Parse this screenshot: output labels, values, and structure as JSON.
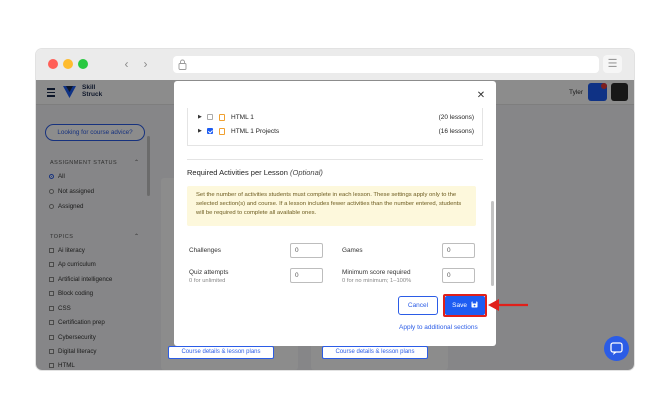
{
  "browser": {
    "dots": [
      "#ff5f57",
      "#febc2e",
      "#28c840"
    ],
    "back_icon": "chevron-left-icon",
    "forward_icon": "chevron-right-icon",
    "menu_icon": "hamburger-icon"
  },
  "app": {
    "logo_line1": "Skill",
    "logo_line2": "Struck",
    "user_name": "Tyler"
  },
  "sidebar": {
    "advice_button": "Looking for course advice?",
    "assignment_status_heading": "ASSIGNMENT STATUS",
    "status_options": [
      "All",
      "Not assigned",
      "Assigned"
    ],
    "selected_status": "All",
    "topics_heading": "TOPICS",
    "topics": [
      "Ai literacy",
      "Ap curriculum",
      "Artificial intelligence",
      "Block coding",
      "CSS",
      "Certification prep",
      "Cybersecurity",
      "Digital literacy",
      "HTML"
    ]
  },
  "cards": {
    "details_button": "Course details & lesson plans"
  },
  "modal": {
    "tree": [
      {
        "label": "HTML 1",
        "count": "(20 lessons)",
        "checked": false
      },
      {
        "label": "HTML 1 Projects",
        "count": "(16 lessons)",
        "checked": true
      }
    ],
    "section_title": "Required Activities per Lesson",
    "section_title_optional": "(Optional)",
    "info_text": "Set the number of activities students must complete in each lesson. These settings apply only to the selected section(s) and course. If a lesson includes fewer activities than the number entered, students will be required to complete all available ones.",
    "fields": {
      "challenges_label": "Challenges",
      "challenges_value": "0",
      "games_label": "Games",
      "games_value": "0",
      "quiz_label": "Quiz attempts",
      "quiz_sub": "0 for unlimited",
      "quiz_value": "0",
      "min_score_label": "Minimum score required",
      "min_score_sub": "0 for no minimum; 1–100%",
      "min_score_value": "0"
    },
    "cancel_label": "Cancel",
    "save_label": "Save",
    "apply_link": "Apply to additional sections"
  },
  "colors": {
    "primary": "#1d5cf2",
    "highlight": "#e0201a",
    "info_bg": "#fdf8dc"
  }
}
